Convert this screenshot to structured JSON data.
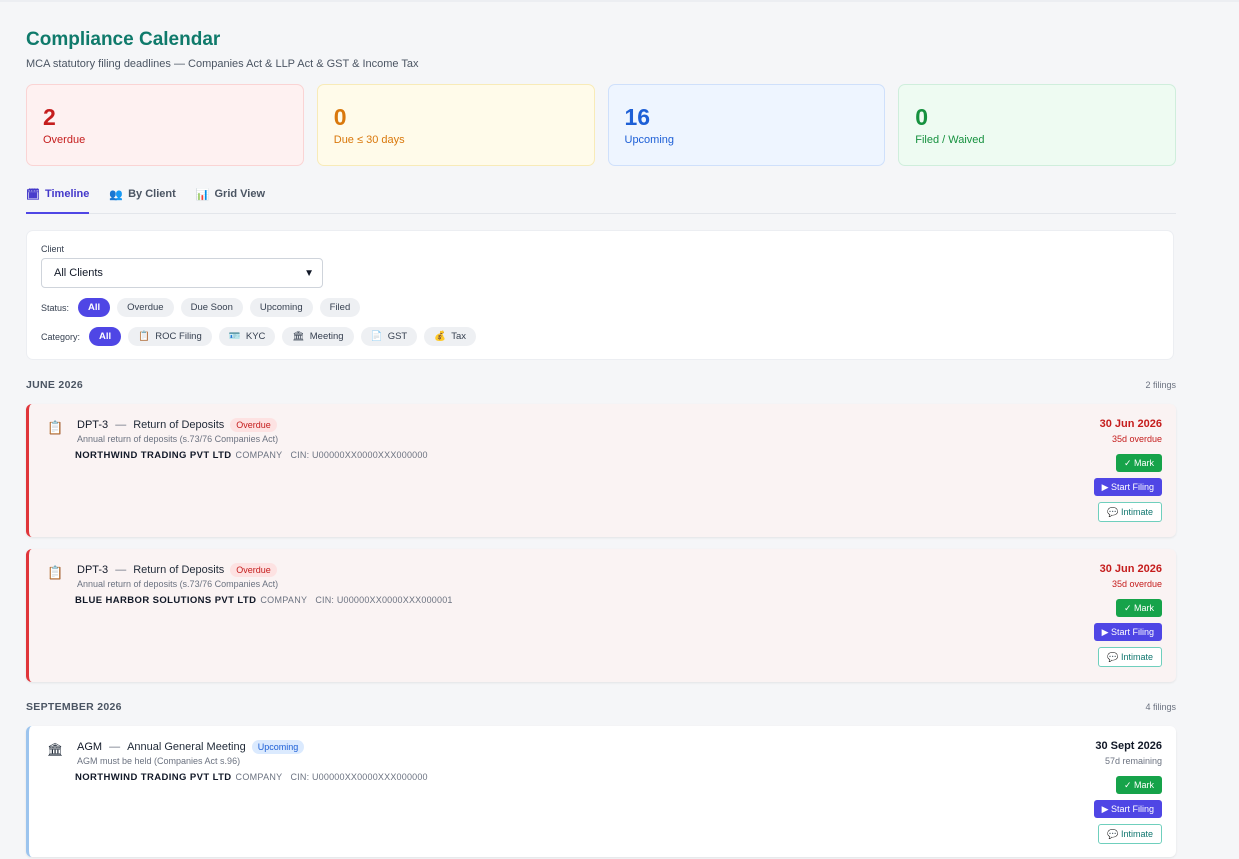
{
  "header": {
    "title": "Compliance Calendar",
    "subtitle": "MCA statutory filing deadlines — Companies Act & LLP Act & GST & Income Tax"
  },
  "stats": [
    {
      "value": "2",
      "label": "Overdue"
    },
    {
      "value": "0",
      "label": "Due ≤ 30 days"
    },
    {
      "value": "16",
      "label": "Upcoming"
    },
    {
      "value": "0",
      "label": "Filed / Waived"
    }
  ],
  "tabs": [
    {
      "icon": "🗓",
      "label": "Timeline"
    },
    {
      "icon": "👥",
      "label": "By Client"
    },
    {
      "icon": "📊",
      "label": "Grid View"
    }
  ],
  "filters": {
    "client_label": "Client",
    "client_value": "All Clients",
    "status_label": "Status:",
    "status_options": [
      "All",
      "Overdue",
      "Due Soon",
      "Upcoming",
      "Filed"
    ],
    "category_label": "Category:",
    "category_options": [
      {
        "icon": "",
        "label": "All"
      },
      {
        "icon": "📋",
        "label": "ROC Filing"
      },
      {
        "icon": "🪪",
        "label": "KYC"
      },
      {
        "icon": "🏛",
        "label": "Meeting"
      },
      {
        "icon": "📄",
        "label": "GST"
      },
      {
        "icon": "💰",
        "label": "Tax"
      }
    ]
  },
  "months": [
    {
      "name": "JUNE 2026",
      "count": "2 filings",
      "items": [
        {
          "icon": "📋",
          "code": "DPT-3",
          "sep": "—",
          "name": "Return of Deposits",
          "badge": "Overdue",
          "desc": "Annual return of deposits (s.73/76 Companies Act)",
          "entity": "NORTHWIND TRADING PVT LTD",
          "type": "COMPANY",
          "cin": "CIN: U00000XX0000XXX000000",
          "date": "30 Jun 2026",
          "rel": "35d overdue",
          "mark": "✓ Mark",
          "start": "▶ Start Filing",
          "intimate": "💬 Intimate"
        },
        {
          "icon": "📋",
          "code": "DPT-3",
          "sep": "—",
          "name": "Return of Deposits",
          "badge": "Overdue",
          "desc": "Annual return of deposits (s.73/76 Companies Act)",
          "entity": "BLUE HARBOR SOLUTIONS PVT LTD",
          "type": "COMPANY",
          "cin": "CIN: U00000XX0000XXX000001",
          "date": "30 Jun 2026",
          "rel": "35d overdue",
          "mark": "✓ Mark",
          "start": "▶ Start Filing",
          "intimate": "💬 Intimate"
        }
      ]
    },
    {
      "name": "SEPTEMBER 2026",
      "count": "4 filings",
      "items": [
        {
          "icon": "🏛",
          "code": "AGM",
          "sep": "—",
          "name": "Annual General Meeting",
          "badge": "Upcoming",
          "desc": "AGM must be held (Companies Act s.96)",
          "entity": "NORTHWIND TRADING PVT LTD",
          "type": "COMPANY",
          "cin": "CIN: U00000XX0000XXX000000",
          "date": "30 Sept 2026",
          "rel": "57d remaining",
          "mark": "✓ Mark",
          "start": "▶ Start Filing",
          "intimate": "💬 Intimate"
        }
      ]
    }
  ]
}
